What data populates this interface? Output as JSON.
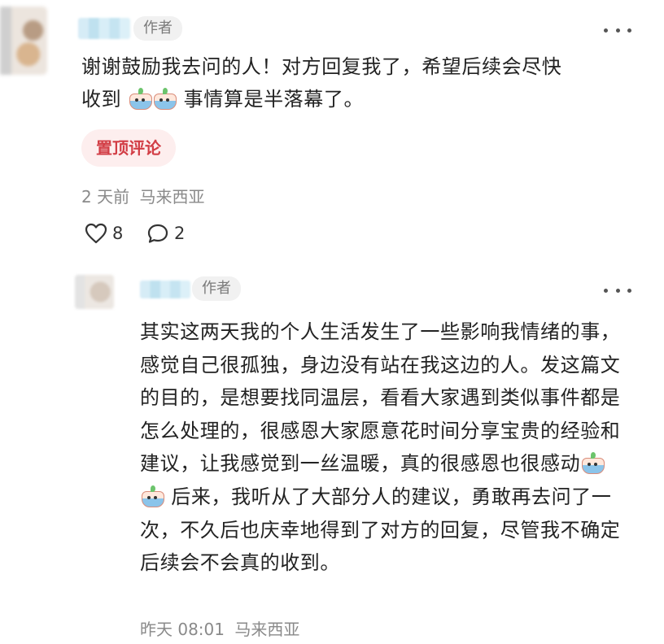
{
  "comment": {
    "author_tag": "作者",
    "text_line1": "谢谢鼓励我去问的人！对方回复我了，希望后续会尽快",
    "text_line2_a": "收到",
    "text_line2_b": "事情算是半落幕了。",
    "emojis": [
      "crying-bowl-icon",
      "crying-bowl-icon"
    ],
    "pin_label": "置顶评论",
    "time": "2 天前",
    "location": "马来西亚",
    "like_count": "8",
    "reply_count": "2"
  },
  "reply": {
    "author_tag": "作者",
    "text_before_emoji": "其实这两天我的个人生活发生了一些影响我情绪的事，感觉自己很孤独，身边没有站在我这边的人。发这篇文的目的，是想要找同温层，看看大家遇到类似事件都是怎么处理的，很感恩大家愿意花时间分享宝贵的经验和建议，让我感觉到一丝温暖，真的很感恩也很感动",
    "text_after_emoji": " 后来，我听从了大部分人的建议，勇敢再去问了一次，不久后也庆幸地得到了对方的回复，尽管我不确定后续会不会真的收到。",
    "emojis": [
      "crying-bowl-icon",
      "crying-bowl-icon"
    ],
    "time": "昨天 08:01",
    "location": "马来西亚"
  },
  "colors": {
    "pin_bg": "#fdeeee",
    "pin_text": "#d23d45",
    "meta_text": "#8a8a8a"
  }
}
